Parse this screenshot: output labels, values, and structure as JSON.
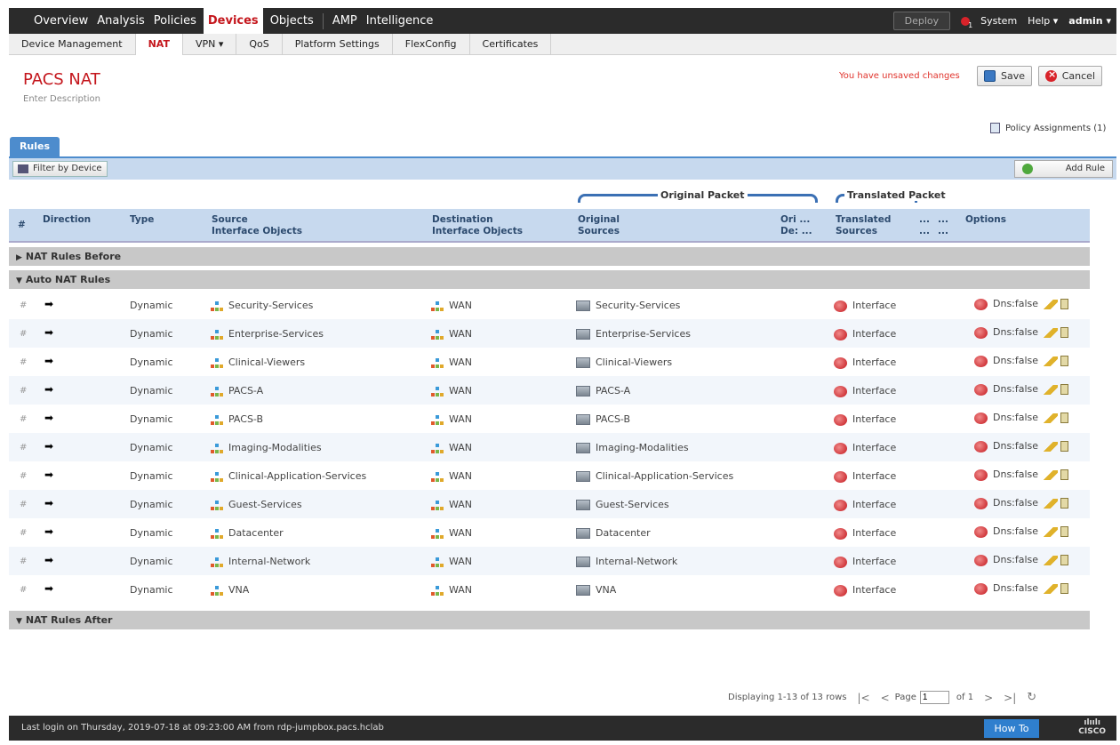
{
  "topnav": {
    "items": [
      "Overview",
      "Analysis",
      "Policies",
      "Devices",
      "Objects",
      "AMP",
      "Intelligence"
    ],
    "active": "Devices",
    "deploy_label": "Deploy",
    "alert_count": "1",
    "system_label": "System",
    "help_label": "Help ▾",
    "user_label": "admin ▾"
  },
  "subnav": {
    "items": [
      "Device Management",
      "NAT",
      "VPN ▾",
      "QoS",
      "Platform Settings",
      "FlexConfig",
      "Certificates"
    ],
    "active": "NAT"
  },
  "page": {
    "title": "PACS NAT",
    "description": "Enter Description",
    "unsaved": "You have unsaved changes",
    "save_label": "Save",
    "cancel_label": "Cancel",
    "policy_assignments": "Policy Assignments (1)"
  },
  "tabs": {
    "rules": "Rules"
  },
  "toolbar": {
    "filter_label": "Filter by Device",
    "add_rule_label": "Add Rule"
  },
  "groups": {
    "original": "Original Packet",
    "translated": "Translated Packet"
  },
  "table": {
    "headers": {
      "num": "#",
      "direction": "Direction",
      "type": "Type",
      "src_intf_1": "Source",
      "src_intf_2": "Interface Objects",
      "dst_intf_1": "Destination",
      "dst_intf_2": "Interface Objects",
      "orig_src_1": "Original",
      "orig_src_2": "Sources",
      "orig_dst_1": "Ori ...",
      "orig_dst_2": "De: ...",
      "trans_src_1": "Translated",
      "trans_src_2": "Sources",
      "trans_x1_1": "...",
      "trans_x1_2": "...",
      "trans_x2_1": "...",
      "trans_x2_2": "...",
      "options": "Options"
    },
    "sections": {
      "before": "NAT Rules Before",
      "auto": "Auto NAT Rules",
      "after": "NAT Rules After"
    },
    "rows": [
      {
        "num": "#",
        "type": "Dynamic",
        "src_intf": "Security-Services",
        "dst_intf": "WAN",
        "orig_src": "Security-Services",
        "trans_src": "Interface",
        "options": "Dns:false"
      },
      {
        "num": "#",
        "type": "Dynamic",
        "src_intf": "Enterprise-Services",
        "dst_intf": "WAN",
        "orig_src": "Enterprise-Services",
        "trans_src": "Interface",
        "options": "Dns:false"
      },
      {
        "num": "#",
        "type": "Dynamic",
        "src_intf": "Clinical-Viewers",
        "dst_intf": "WAN",
        "orig_src": "Clinical-Viewers",
        "trans_src": "Interface",
        "options": "Dns:false"
      },
      {
        "num": "#",
        "type": "Dynamic",
        "src_intf": "PACS-A",
        "dst_intf": "WAN",
        "orig_src": "PACS-A",
        "trans_src": "Interface",
        "options": "Dns:false"
      },
      {
        "num": "#",
        "type": "Dynamic",
        "src_intf": "PACS-B",
        "dst_intf": "WAN",
        "orig_src": "PACS-B",
        "trans_src": "Interface",
        "options": "Dns:false"
      },
      {
        "num": "#",
        "type": "Dynamic",
        "src_intf": "Imaging-Modalities",
        "dst_intf": "WAN",
        "orig_src": "Imaging-Modalities",
        "trans_src": "Interface",
        "options": "Dns:false"
      },
      {
        "num": "#",
        "type": "Dynamic",
        "src_intf": "Clinical-Application-Services",
        "dst_intf": "WAN",
        "orig_src": "Clinical-Application-Services",
        "trans_src": "Interface",
        "options": "Dns:false"
      },
      {
        "num": "#",
        "type": "Dynamic",
        "src_intf": "Guest-Services",
        "dst_intf": "WAN",
        "orig_src": "Guest-Services",
        "trans_src": "Interface",
        "options": "Dns:false"
      },
      {
        "num": "#",
        "type": "Dynamic",
        "src_intf": "Datacenter",
        "dst_intf": "WAN",
        "orig_src": "Datacenter",
        "trans_src": "Interface",
        "options": "Dns:false"
      },
      {
        "num": "#",
        "type": "Dynamic",
        "src_intf": "Internal-Network",
        "dst_intf": "WAN",
        "orig_src": "Internal-Network",
        "trans_src": "Interface",
        "options": "Dns:false"
      },
      {
        "num": "#",
        "type": "Dynamic",
        "src_intf": "VNA",
        "dst_intf": "WAN",
        "orig_src": "VNA",
        "trans_src": "Interface",
        "options": "Dns:false"
      }
    ]
  },
  "pagination": {
    "status": "Displaying 1-13 of 13 rows",
    "page_label": "Page",
    "page_value": "1",
    "of_label": "of 1"
  },
  "footer": {
    "last_login": "Last login on Thursday, 2019-07-18 at 09:23:00 AM from rdp-jumpbox.pacs.hclab",
    "how_to": "How To",
    "logo_text": "CISCO"
  },
  "icons": {
    "direction": "arrow-right-icon",
    "interface_object": "network-object-icon",
    "network_object": "server-object-icon",
    "translated_interface": "interface-icon",
    "options": "dns-option-icon"
  },
  "colors": {
    "brand_red": "#c4161c",
    "header_blue": "#c7d9ee",
    "tab_blue": "#4d8ccd"
  }
}
